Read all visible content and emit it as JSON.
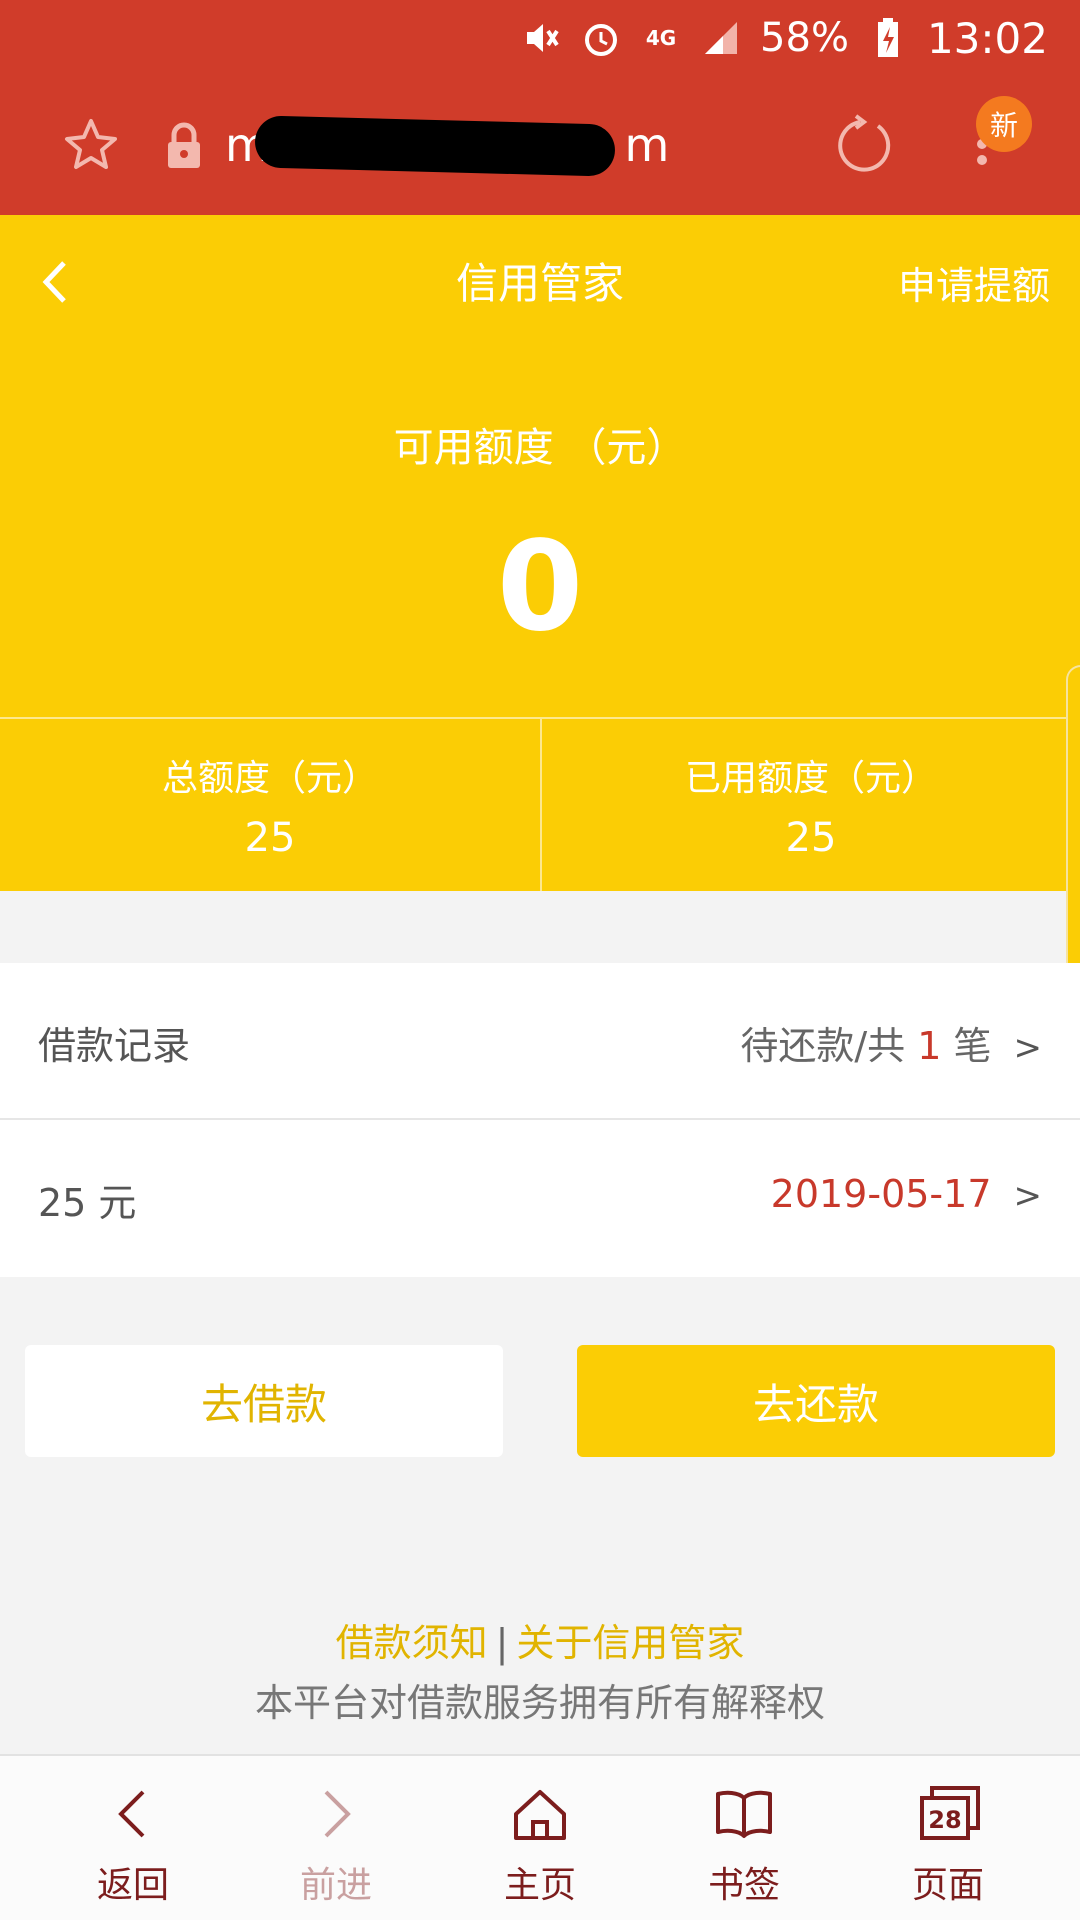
{
  "status_bar": {
    "battery": "58%",
    "time": "13:02",
    "network": "4G"
  },
  "browser": {
    "url_prefix": "m.",
    "url_suffix": "m",
    "new_badge": "新"
  },
  "header": {
    "title": "信用管家",
    "action": "申请提额"
  },
  "credit": {
    "available_label": "可用额度 （元）",
    "available_value": "0",
    "total_label": "总额度（元）",
    "total_value": "25",
    "used_label": "已用额度（元）",
    "used_value": "25"
  },
  "records": {
    "title": "借款记录",
    "summary_prefix": "待还款/共 ",
    "summary_count": "1",
    "summary_suffix": " 笔",
    "chevron": ">",
    "item_amount": "25 元",
    "item_date": "2019-05-17"
  },
  "actions": {
    "borrow": "去借款",
    "repay": "去还款"
  },
  "footer": {
    "link1": "借款须知",
    "separator": "|",
    "link2": "关于信用管家",
    "disclaimer": "本平台对借款服务拥有所有解释权"
  },
  "nav": {
    "back": "返回",
    "forward": "前进",
    "home": "主页",
    "bookmarks": "书签",
    "tabs": "页面",
    "tab_count": "28"
  },
  "colors": {
    "browser_red": "#d03c2a",
    "brand_yellow": "#fbcd05",
    "accent_red": "#c8392b",
    "nav_icon": "#7c1d1d"
  }
}
